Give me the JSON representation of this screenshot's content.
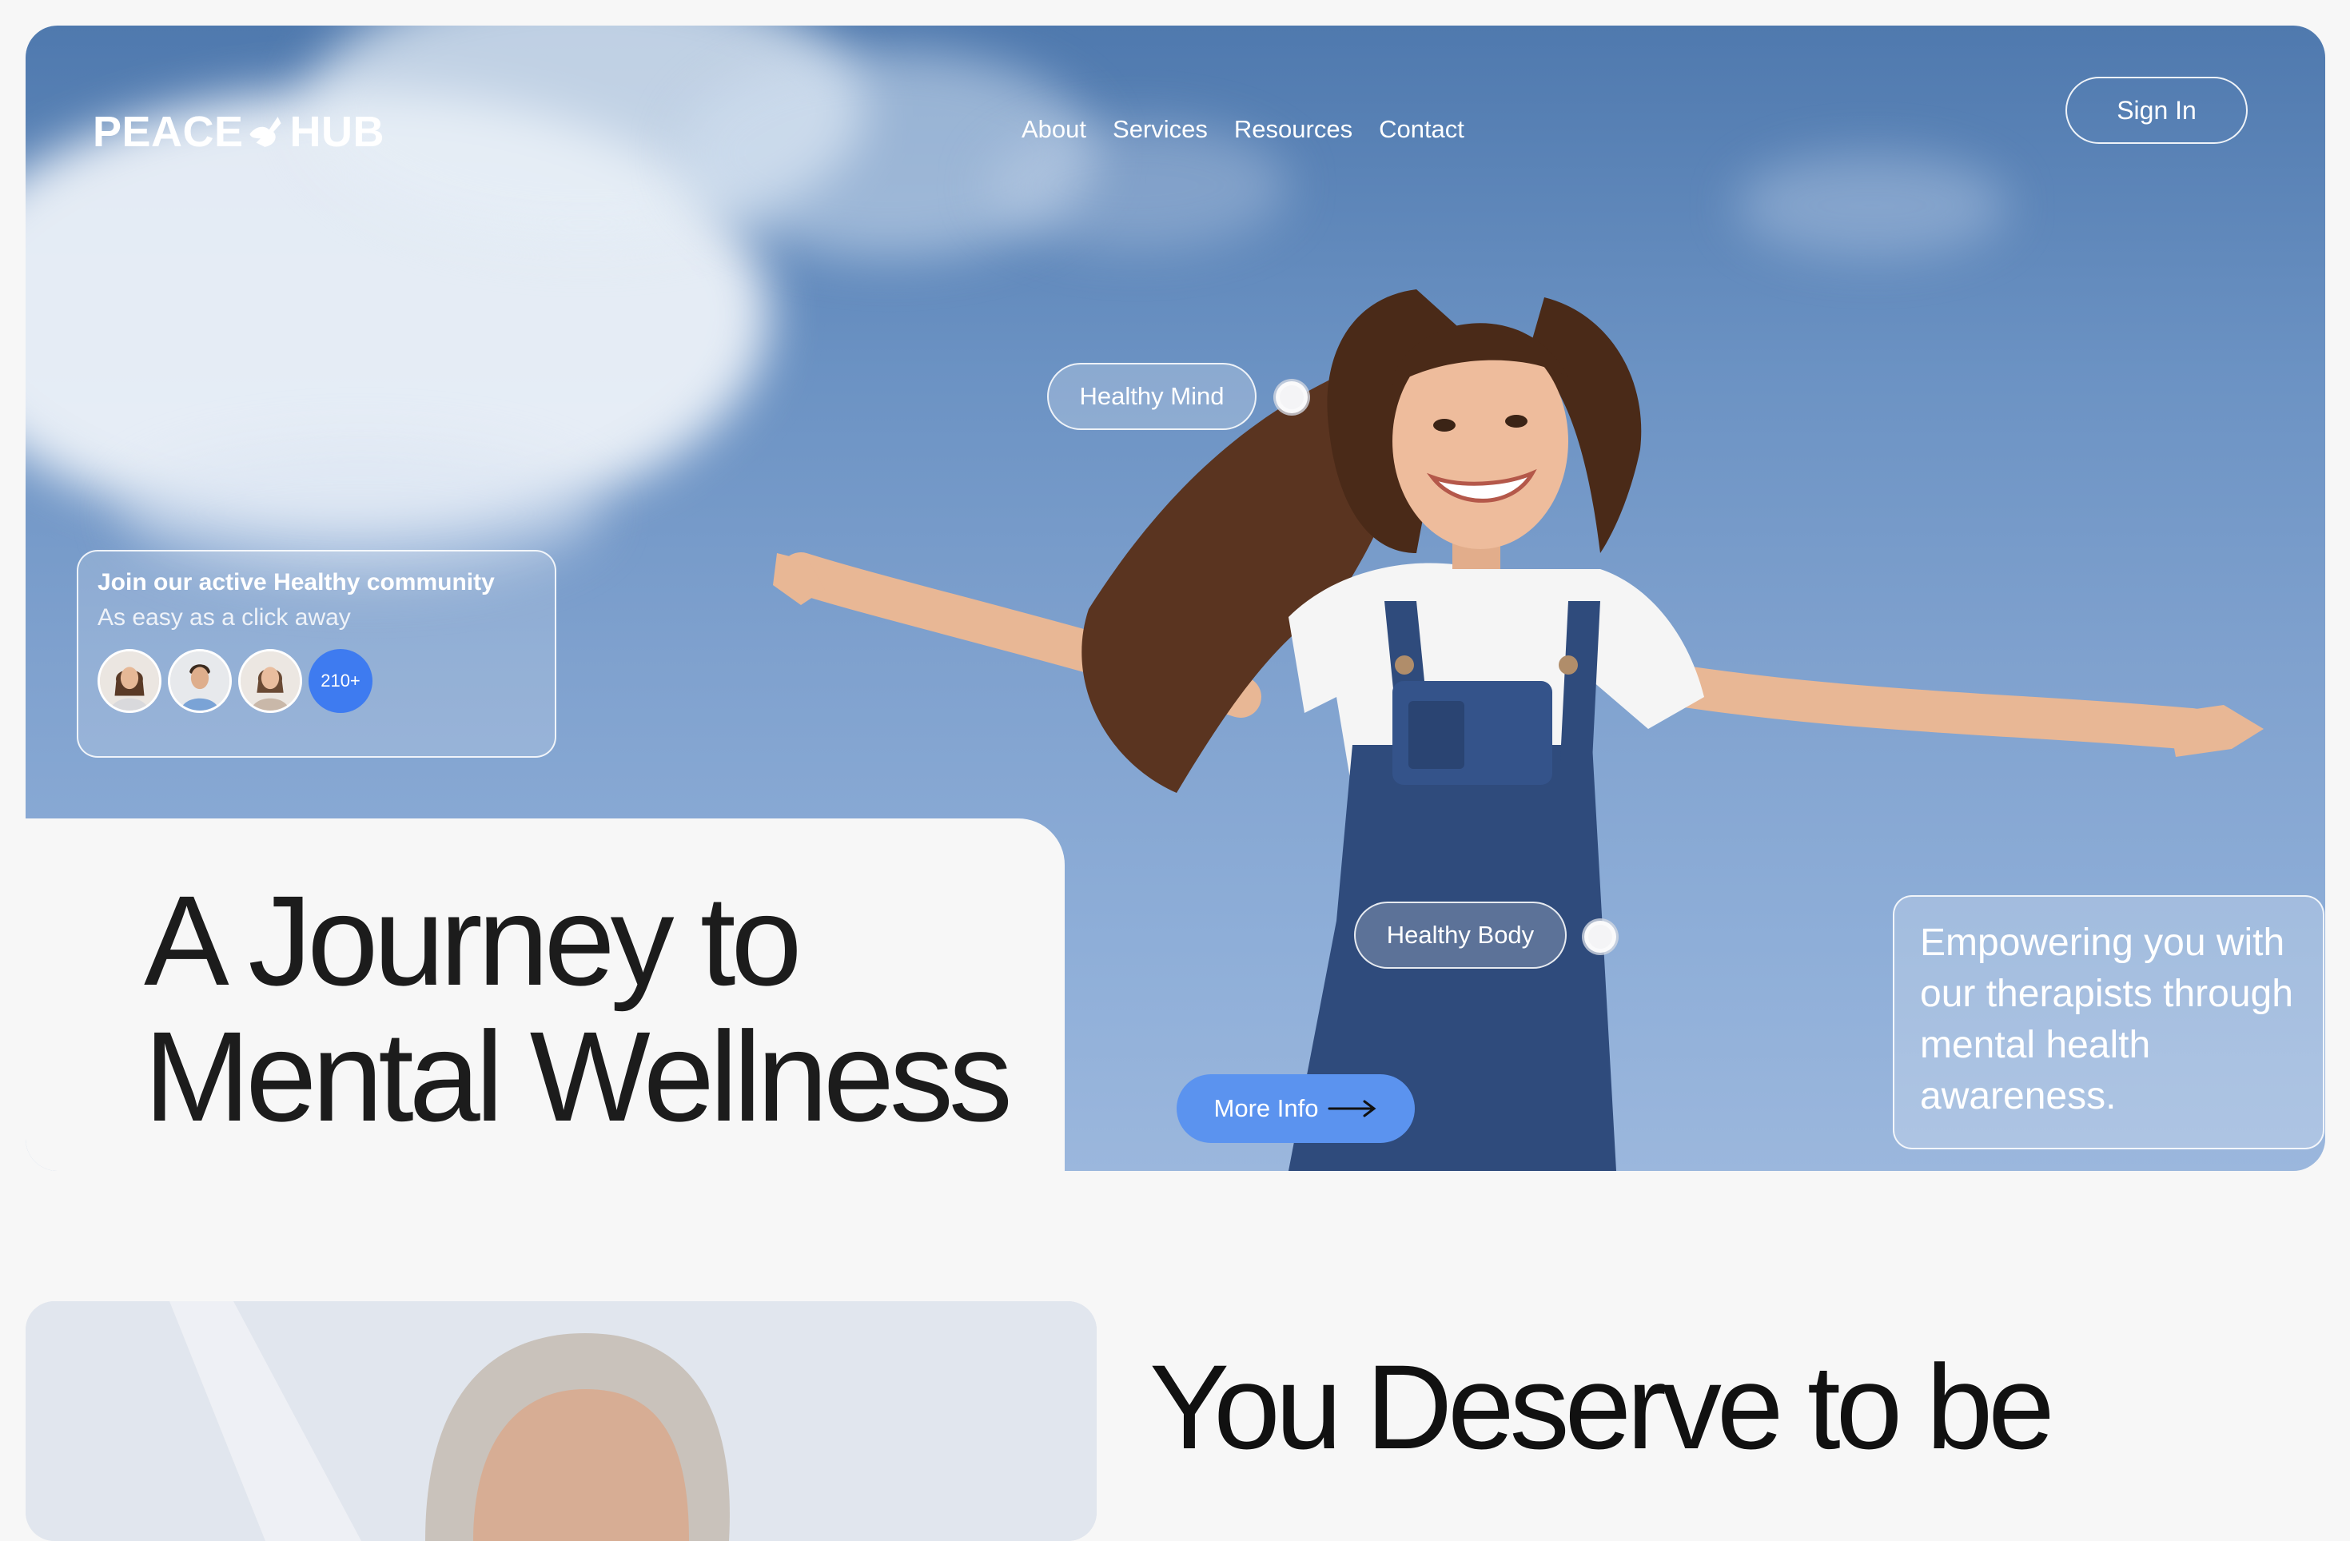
{
  "brand": {
    "logo_left": "PEACE",
    "logo_right": "HUB"
  },
  "nav": {
    "items": [
      "About",
      "Services",
      "Resources",
      "Contact"
    ],
    "signin": "Sign In"
  },
  "hero": {
    "pill_mind": "Healthy Mind",
    "pill_body": "Healthy Body",
    "headline_line1": "A Journey to",
    "headline_line2": "Mental Wellness",
    "more_info": "More Info",
    "empower": "Empowering you with our therapists through mental health awareness."
  },
  "community": {
    "title": "Join our active Healthy community",
    "subtitle": "As easy as a click away",
    "count": "210+"
  },
  "section2": {
    "heading": "You Deserve to be"
  },
  "colors": {
    "accent": "#5b93ef",
    "badge": "#3e7bf0",
    "sky": "#6b92c3",
    "bg": "#f7f7f7",
    "text": "#1c1c1c"
  },
  "icons": [
    "dove-icon",
    "arrow-right-icon",
    "avatar-icon"
  ]
}
